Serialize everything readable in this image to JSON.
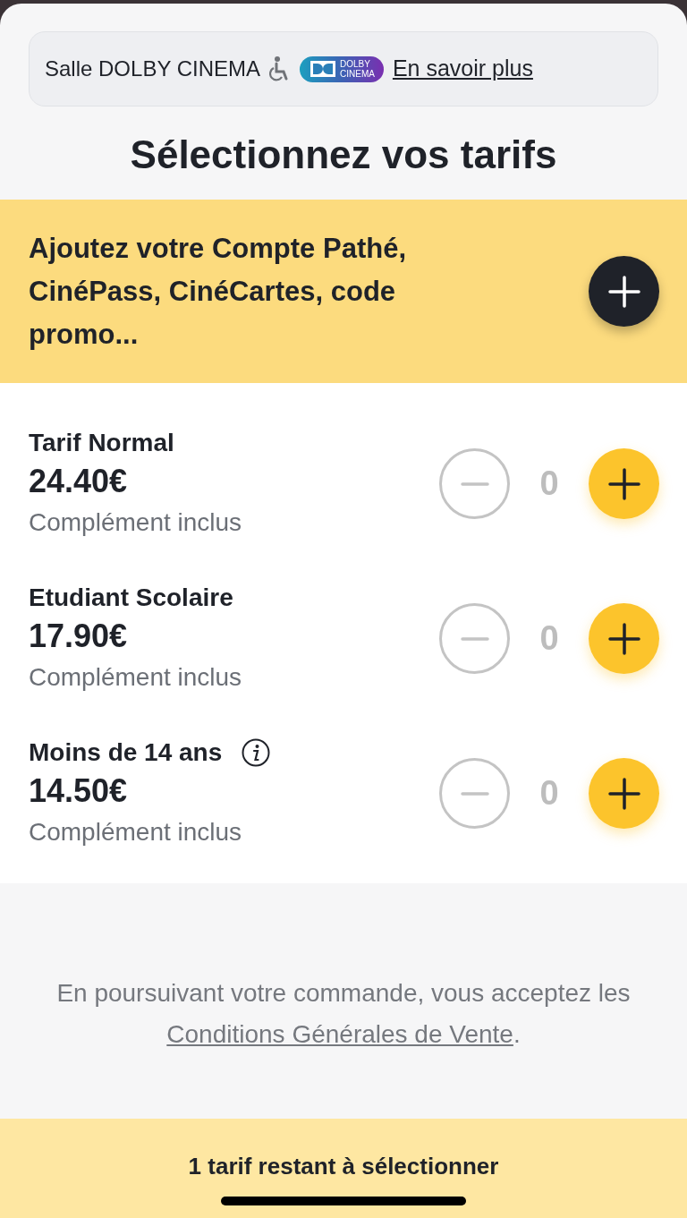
{
  "hall": {
    "label": "Salle DOLBY CINEMA",
    "accessible": true,
    "logo_lines": [
      "DOLBY",
      "CINEMA"
    ],
    "link": "En savoir plus"
  },
  "title": "Sélectionnez vos tarifs",
  "promo": {
    "text": "Ajoutez votre Compte Pathé, CinéPass, CinéCartes, code promo..."
  },
  "tariffs": [
    {
      "name": "Tarif Normal",
      "info": false,
      "price": "24.40€",
      "note": "Complément inclus",
      "count": "0",
      "minus_disabled": true
    },
    {
      "name": "Etudiant Scolaire",
      "info": false,
      "price": "17.90€",
      "note": "Complément inclus",
      "count": "0",
      "minus_disabled": true
    },
    {
      "name": "Moins de 14 ans",
      "info": true,
      "price": "14.50€",
      "note": "Complément inclus",
      "count": "0",
      "minus_disabled": true
    }
  ],
  "terms": {
    "text": "En poursuivant votre commande, vous acceptez les",
    "link": "Conditions Générales de Vente",
    "end": "."
  },
  "footer": {
    "text": "1 tarif restant à sélectionner"
  }
}
